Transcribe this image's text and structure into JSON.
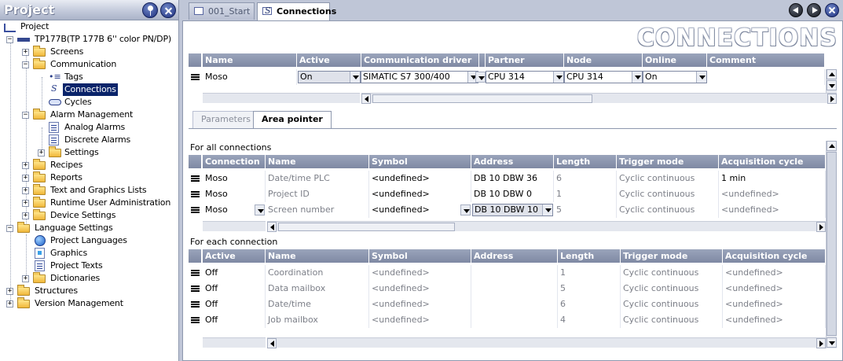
{
  "left": {
    "title": "Project",
    "tree": [
      {
        "label": "Project",
        "icon": "project-icon"
      },
      {
        "label": "TP177B(TP 177B 6'' color PN/DP)",
        "icon": "device-icon"
      },
      {
        "label": "Screens",
        "icon": "folder-icon"
      },
      {
        "label": "Communication",
        "icon": "folder-icon"
      },
      {
        "label": "Tags",
        "icon": "tag-icon"
      },
      {
        "label": "Connections",
        "icon": "conn-icon"
      },
      {
        "label": "Cycles",
        "icon": "cycle-icon"
      },
      {
        "label": "Alarm Management",
        "icon": "folder-icon"
      },
      {
        "label": "Analog Alarms",
        "icon": "doc-icon"
      },
      {
        "label": "Discrete Alarms",
        "icon": "doc-icon"
      },
      {
        "label": "Settings",
        "icon": "folder-icon"
      },
      {
        "label": "Recipes",
        "icon": "folder-icon"
      },
      {
        "label": "Reports",
        "icon": "folder-icon"
      },
      {
        "label": "Text and Graphics Lists",
        "icon": "folder-icon"
      },
      {
        "label": "Runtime User Administration",
        "icon": "folder-icon"
      },
      {
        "label": "Device Settings",
        "icon": "folder-icon"
      },
      {
        "label": "Language Settings",
        "icon": "folder-icon"
      },
      {
        "label": "Project Languages",
        "icon": "globe-icon"
      },
      {
        "label": "Graphics",
        "icon": "graph-icon"
      },
      {
        "label": "Project Texts",
        "icon": "doc-icon"
      },
      {
        "label": "Dictionaries",
        "icon": "folder-icon"
      },
      {
        "label": "Structures",
        "icon": "folder-icon"
      },
      {
        "label": "Version Management",
        "icon": "folder-icon"
      }
    ]
  },
  "tabs": [
    {
      "label": "001_Start"
    },
    {
      "label": "Connections"
    }
  ],
  "page_title": "CONNECTIONS",
  "connections": {
    "headers": [
      "Name",
      "Active",
      "Communication driver",
      "",
      "Partner",
      "Node",
      "Online",
      "Comment"
    ],
    "row": {
      "name": "Moso",
      "active": "On",
      "driver": "SIMATIC S7 300/400",
      "partner": "CPU 314",
      "node": "CPU 314",
      "online": "On",
      "comment": ""
    }
  },
  "sub_tabs": [
    "Parameters",
    "Area pointer"
  ],
  "all_connections": {
    "label": "For all connections",
    "headers": [
      "Connection",
      "Name",
      "Symbol",
      "Address",
      "Length",
      "Trigger mode",
      "Acquisition cycle"
    ],
    "rows": [
      [
        "Moso",
        "Date/time PLC",
        "<undefined>",
        "DB 10 DBW 36",
        "6",
        "Cyclic continuous",
        "1 min"
      ],
      [
        "Moso",
        "Project ID",
        "<undefined>",
        "DB 10 DBW 0",
        "1",
        "Cyclic continuous",
        "<undefined>"
      ],
      [
        "Moso",
        "Screen number",
        "<undefined>",
        "DB 10 DBW 10",
        "5",
        "Cyclic continuous",
        "<undefined>"
      ]
    ]
  },
  "each_connection": {
    "label": "For each connection",
    "headers": [
      "Active",
      "Name",
      "Symbol",
      "Address",
      "Length",
      "Trigger mode",
      "Acquisition cycle"
    ],
    "rows": [
      [
        "Off",
        "Coordination",
        "<undefined>",
        "",
        "1",
        "Cyclic continuous",
        "<undefined>"
      ],
      [
        "Off",
        "Data mailbox",
        "<undefined>",
        "",
        "5",
        "Cyclic continuous",
        "<undefined>"
      ],
      [
        "Off",
        "Date/time",
        "<undefined>",
        "",
        "6",
        "Cyclic continuous",
        "<undefined>"
      ],
      [
        "Off",
        "Job mailbox",
        "<undefined>",
        "",
        "4",
        "Cyclic continuous",
        "<undefined>"
      ]
    ]
  },
  "colors": {
    "header_bg": "#8c96af",
    "selection": "#0a246a",
    "panel_bg": "#bfc6d7"
  }
}
